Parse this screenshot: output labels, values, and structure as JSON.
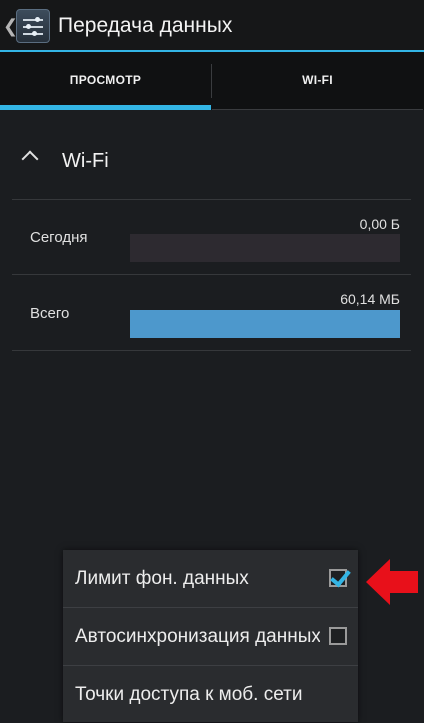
{
  "action_bar": {
    "title": "Передача данных",
    "up_icon": "chevron-left-icon",
    "app_icon": "data-usage-settings-icon"
  },
  "tabs": [
    {
      "label": "ПРОСМОТР",
      "selected": true
    },
    {
      "label": "WI-FI",
      "selected": false
    }
  ],
  "section": {
    "title": "Wi-Fi",
    "icon": "chevron-up-icon"
  },
  "usage_rows": [
    {
      "label": "Сегодня",
      "value": "0,00 Б",
      "fill_fraction": 0.0
    },
    {
      "label": "Всего",
      "value": "60,14 МБ",
      "fill_fraction": 1.0
    }
  ],
  "menu": {
    "items": [
      {
        "label": "Лимит фон. данных",
        "checkbox": true,
        "checked": true
      },
      {
        "label": "Автосинхронизация данных",
        "checkbox": true,
        "checked": false
      },
      {
        "label": "Точки доступа к моб. сети",
        "checkbox": false
      }
    ]
  },
  "colors": {
    "accent": "#33b5e5",
    "bar_fill": "#4d98cc",
    "bar_track": "#2d2a30",
    "annotation_arrow": "#e8101a"
  }
}
